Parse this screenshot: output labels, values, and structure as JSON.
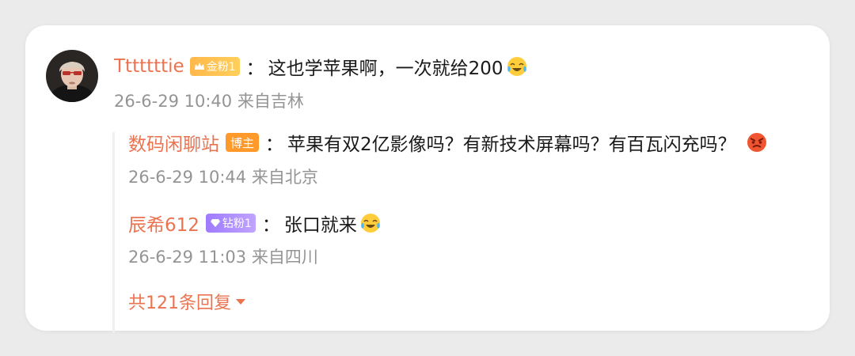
{
  "comment": {
    "username": "Tttttttie",
    "badge": "金粉1",
    "text": "这也学苹果啊，一次就给200",
    "meta": "26-6-29 10:40 来自吉林"
  },
  "replies": [
    {
      "username": "数码闲聊站",
      "badge": "博主",
      "text": "苹果有双2亿影像吗？有新技术屏幕吗？有百瓦闪充吗？",
      "meta": "26-6-29 10:44 来自北京"
    },
    {
      "username": "辰希612",
      "badge": "钻粉1",
      "text": "张口就来",
      "meta": "26-6-29 11:03 来自四川"
    }
  ],
  "more_replies": "共121条回复",
  "colon": "：",
  "colors": {
    "username": "#eb7350",
    "meta": "#949494",
    "gold_badge": "#ffb84a",
    "bozhu_badge": "#ff9a2a",
    "diamond_badge": "#9e7bff"
  },
  "icons": [
    "avatar",
    "crown-icon",
    "laughing-crying-emoji",
    "angry-emoji",
    "diamond-icon",
    "caret-down-icon"
  ]
}
